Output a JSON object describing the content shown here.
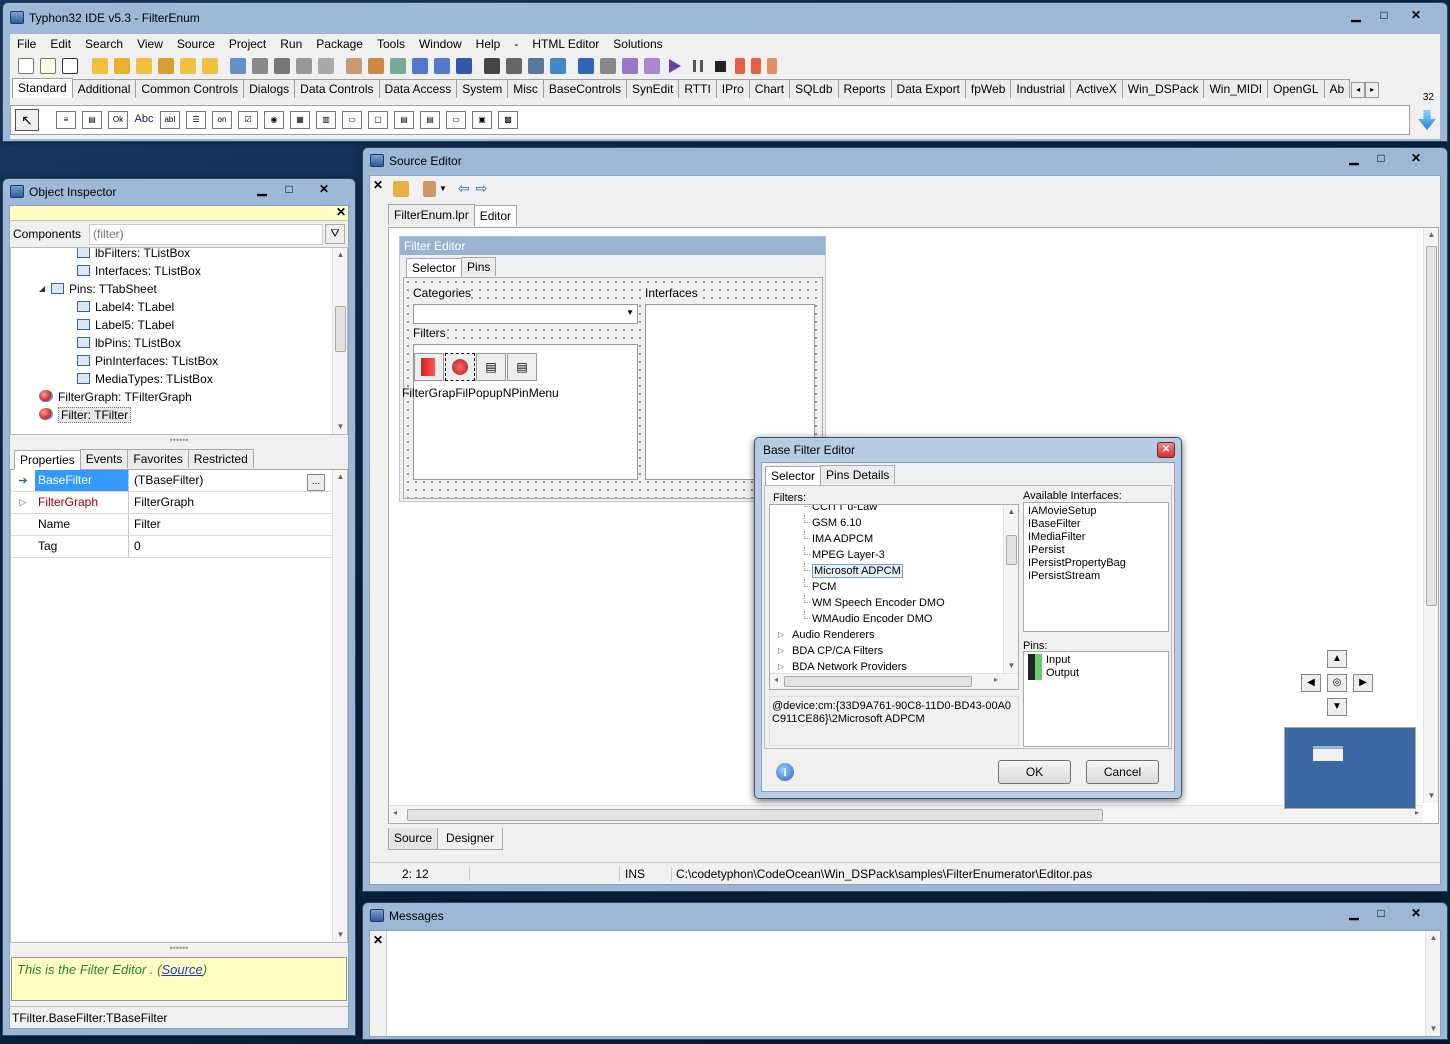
{
  "main_window": {
    "title": "Typhon32 IDE v5.3 - FilterEnum",
    "menu": [
      "File",
      "Edit",
      "Search",
      "View",
      "Source",
      "Project",
      "Run",
      "Package",
      "Tools",
      "Window",
      "Help",
      "-",
      "HTML Editor",
      "Solutions"
    ],
    "palette_tabs": [
      "Standard",
      "Additional",
      "Common Controls",
      "Dialogs",
      "Data Controls",
      "Data Access",
      "System",
      "Misc",
      "BaseControls",
      "SynEdit",
      "RTTI",
      "IPro",
      "Chart",
      "SQLdb",
      "Reports",
      "Data Export",
      "fpWeb",
      "Industrial",
      "ActiveX",
      "Win_DSPack",
      "Win_MIDI",
      "OpenGL",
      "Ab"
    ],
    "bitness": "32",
    "palette_components": [
      "Ok",
      "Abc",
      "abI",
      "on"
    ]
  },
  "object_inspector": {
    "title": "Object Inspector",
    "components_label": "Components",
    "filter_placeholder": "(filter)",
    "tree": [
      {
        "label": "lbFilters: TListBox",
        "indent": 1
      },
      {
        "label": "Interfaces: TListBox",
        "indent": 1
      },
      {
        "label": "Pins: TTabSheet",
        "indent": 0
      },
      {
        "label": "Label4: TLabel",
        "indent": 1
      },
      {
        "label": "Label5: TLabel",
        "indent": 1
      },
      {
        "label": "lbPins: TListBox",
        "indent": 1
      },
      {
        "label": "PinInterfaces: TListBox",
        "indent": 1
      },
      {
        "label": "MediaTypes: TListBox",
        "indent": 1
      },
      {
        "label": "FilterGraph: TFilterGraph",
        "indent": -1
      },
      {
        "label": "Filter: TFilter",
        "indent": -1
      }
    ],
    "tabs": [
      "Properties",
      "Events",
      "Favorites",
      "Restricted"
    ],
    "properties": [
      {
        "name": "BaseFilter",
        "value": "(TBaseFilter)"
      },
      {
        "name": "FilterGraph",
        "value": "FilterGraph"
      },
      {
        "name": "Name",
        "value": "Filter"
      },
      {
        "name": "Tag",
        "value": "0"
      }
    ],
    "hint_text": "This is the Filter Editor .",
    "hint_link": "Source",
    "status": "TFilter.BaseFilter:TBaseFilter"
  },
  "source_editor": {
    "title": "Source Editor",
    "tabs": [
      "FilterEnum.lpr",
      "Editor"
    ],
    "bottom_tabs": [
      "Source",
      "Designer"
    ],
    "status": {
      "pos": "2: 12",
      "mode": "INS",
      "path": "C:\\codetyphon\\CodeOcean\\Win_DSPack\\samples\\FilterEnumerator\\Editor.pas"
    }
  },
  "designer_form": {
    "title": "Filter Editor",
    "tabs": [
      "Selector",
      "Pins"
    ],
    "categories_label": "Categories",
    "interfaces_label": "Interfaces",
    "filters_label": "Filters",
    "component_captions": "FilterGrapFilPopupNPinMenu"
  },
  "base_filter_editor": {
    "title": "Base Filter Editor",
    "tabs": [
      "Selector",
      "Pins Details"
    ],
    "filters_label": "Filters:",
    "available_label": "Available Interfaces:",
    "pins_label": "Pins:",
    "filters": [
      "CCITT u-Law",
      "GSM 6.10",
      "IMA ADPCM",
      "MPEG Layer-3",
      "Microsoft ADPCM",
      "PCM",
      "WM Speech Encoder DMO",
      "WMAudio Encoder DMO"
    ],
    "groups": [
      "Audio Renderers",
      "BDA CP/CA Filters",
      "BDA Network Providers"
    ],
    "selected": "Microsoft ADPCM",
    "interfaces": [
      "IAMovieSetup",
      "IBaseFilter",
      "IMediaFilter",
      "IPersist",
      "IPersistPropertyBag",
      "IPersistStream"
    ],
    "pins": [
      "Input",
      "Output"
    ],
    "moniker": "@device:cm:{33D9A761-90C8-11D0-BD43-00A0C911CE86}\\2Microsoft ADPCM",
    "ok": "OK",
    "cancel": "Cancel"
  },
  "messages": {
    "title": "Messages"
  },
  "colors": {
    "accent_selection": "#3399ff",
    "hint_bg": "#ffffc4",
    "designer_title": "#99b4d1"
  }
}
